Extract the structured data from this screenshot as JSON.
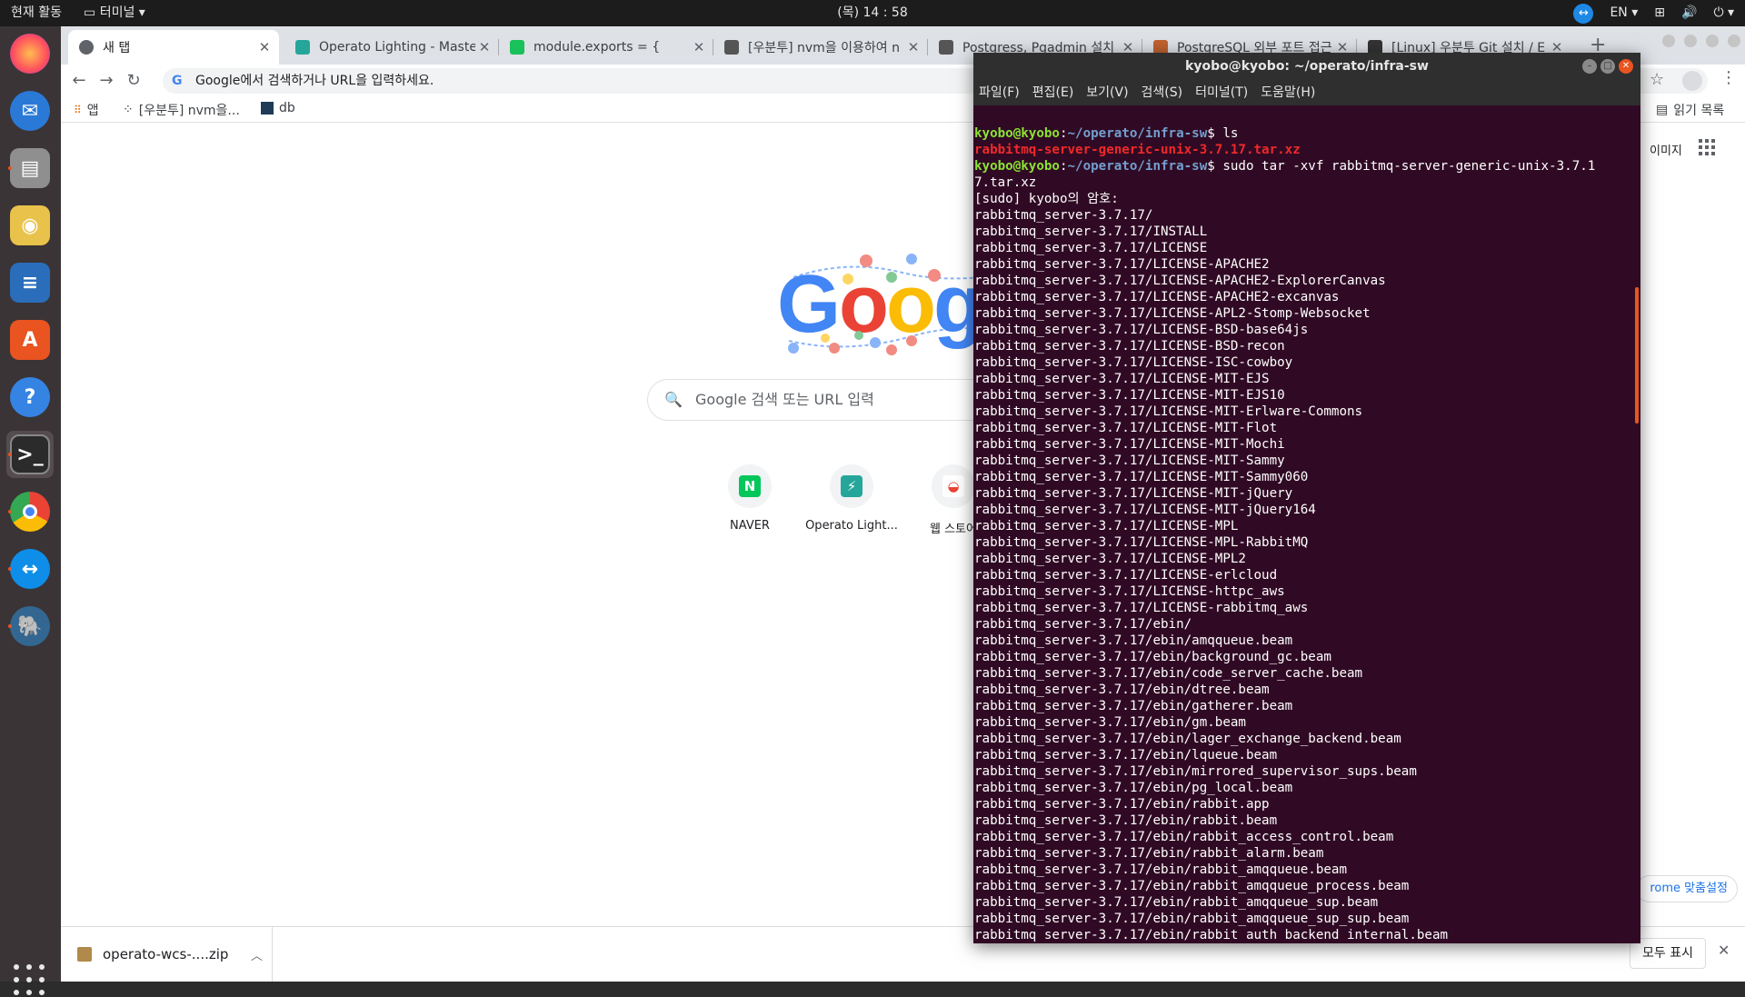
{
  "topbar": {
    "activities": "현재 활동",
    "app_name": "터미널",
    "clock": "(목) 14 : 58",
    "lang": "EN"
  },
  "dock": {
    "items": [
      "firefox-icon",
      "thunderbird-icon",
      "files-icon",
      "rhythmbox-icon",
      "libreoffice-writer-icon",
      "software-center-icon",
      "help-icon",
      "terminal-icon",
      "chrome-icon",
      "teamviewer-icon",
      "pgadmin-icon"
    ]
  },
  "chrome": {
    "tabs": [
      {
        "label": "새 탭"
      },
      {
        "label": "Operato Lighting - Master"
      },
      {
        "label": "module.exports = {"
      },
      {
        "label": "[우분투] nvm을 이용하여 n"
      },
      {
        "label": "Postgress, Pgadmin 설치"
      },
      {
        "label": "PostgreSQL 외부 포트 접근"
      },
      {
        "label": "[Linux] 우분투 Git 설치 / E"
      }
    ],
    "omnibox_placeholder": "Google에서 검색하거나 URL을 입력하세요.",
    "bookmarks": {
      "apps": "앱",
      "nvm": "[우분투] nvm을...",
      "db": "db",
      "reading_list": "읽기 목록"
    },
    "ntp": {
      "images_link": "이미지",
      "search_placeholder": "Google 검색 또는 URL 입력",
      "shortcuts": [
        {
          "label": "NAVER",
          "letter": "N",
          "color": "#03c75a"
        },
        {
          "label": "Operato Light...",
          "letter": "⚡",
          "color": "#26a69a"
        },
        {
          "label": "웹 스토어",
          "letter": "◒",
          "color": "#ea4335"
        }
      ],
      "customize": "rome 맞춤설정"
    },
    "downloads": {
      "file": "operato-wcs-....zip",
      "show_all": "모두 표시"
    }
  },
  "terminal": {
    "title": "kyobo@kyobo: ~/operato/infra-sw",
    "menu": [
      "파일(F)",
      "편집(E)",
      "보기(V)",
      "검색(S)",
      "터미널(T)",
      "도움말(H)"
    ],
    "prompt_user": "kyobo@kyobo",
    "prompt_path": "~/operato/infra-sw",
    "cmd1": " ls",
    "ls_output": "rabbitmq-server-generic-unix-3.7.17.tar.xz",
    "cmd2": " sudo tar -xvf rabbitmq-server-generic-unix-3.7.1",
    "cmd2_cont": "7.tar.xz",
    "output_lines": [
      "[sudo] kyobo의 암호:",
      "rabbitmq_server-3.7.17/",
      "rabbitmq_server-3.7.17/INSTALL",
      "rabbitmq_server-3.7.17/LICENSE",
      "rabbitmq_server-3.7.17/LICENSE-APACHE2",
      "rabbitmq_server-3.7.17/LICENSE-APACHE2-ExplorerCanvas",
      "rabbitmq_server-3.7.17/LICENSE-APACHE2-excanvas",
      "rabbitmq_server-3.7.17/LICENSE-APL2-Stomp-Websocket",
      "rabbitmq_server-3.7.17/LICENSE-BSD-base64js",
      "rabbitmq_server-3.7.17/LICENSE-BSD-recon",
      "rabbitmq_server-3.7.17/LICENSE-ISC-cowboy",
      "rabbitmq_server-3.7.17/LICENSE-MIT-EJS",
      "rabbitmq_server-3.7.17/LICENSE-MIT-EJS10",
      "rabbitmq_server-3.7.17/LICENSE-MIT-Erlware-Commons",
      "rabbitmq_server-3.7.17/LICENSE-MIT-Flot",
      "rabbitmq_server-3.7.17/LICENSE-MIT-Mochi",
      "rabbitmq_server-3.7.17/LICENSE-MIT-Sammy",
      "rabbitmq_server-3.7.17/LICENSE-MIT-Sammy060",
      "rabbitmq_server-3.7.17/LICENSE-MIT-jQuery",
      "rabbitmq_server-3.7.17/LICENSE-MIT-jQuery164",
      "rabbitmq_server-3.7.17/LICENSE-MPL",
      "rabbitmq_server-3.7.17/LICENSE-MPL-RabbitMQ",
      "rabbitmq_server-3.7.17/LICENSE-MPL2",
      "rabbitmq_server-3.7.17/LICENSE-erlcloud",
      "rabbitmq_server-3.7.17/LICENSE-httpc_aws",
      "rabbitmq_server-3.7.17/LICENSE-rabbitmq_aws",
      "rabbitmq_server-3.7.17/ebin/",
      "rabbitmq_server-3.7.17/ebin/amqqueue.beam",
      "rabbitmq_server-3.7.17/ebin/background_gc.beam",
      "rabbitmq_server-3.7.17/ebin/code_server_cache.beam",
      "rabbitmq_server-3.7.17/ebin/dtree.beam",
      "rabbitmq_server-3.7.17/ebin/gatherer.beam",
      "rabbitmq_server-3.7.17/ebin/gm.beam",
      "rabbitmq_server-3.7.17/ebin/lager_exchange_backend.beam",
      "rabbitmq_server-3.7.17/ebin/lqueue.beam",
      "rabbitmq_server-3.7.17/ebin/mirrored_supervisor_sups.beam",
      "rabbitmq_server-3.7.17/ebin/pg_local.beam",
      "rabbitmq_server-3.7.17/ebin/rabbit.app",
      "rabbitmq_server-3.7.17/ebin/rabbit.beam",
      "rabbitmq_server-3.7.17/ebin/rabbit_access_control.beam",
      "rabbitmq_server-3.7.17/ebin/rabbit_alarm.beam",
      "rabbitmq_server-3.7.17/ebin/rabbit_amqqueue.beam",
      "rabbitmq_server-3.7.17/ebin/rabbit_amqqueue_process.beam",
      "rabbitmq_server-3.7.17/ebin/rabbit_amqqueue_sup.beam",
      "rabbitmq_server-3.7.17/ebin/rabbit_amqqueue_sup_sup.beam",
      "rabbitmq_server-3.7.17/ebin/rabbit_auth_backend_internal.beam"
    ]
  }
}
